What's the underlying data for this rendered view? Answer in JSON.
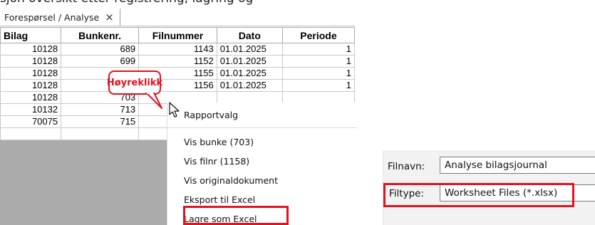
{
  "partial_heading": "sjon oversikt etter registrering, lagring og",
  "tab": {
    "label": "Forespørsel / Analyse",
    "close": "×"
  },
  "table": {
    "headers": [
      "Bilag",
      "Bunkenr.",
      "Filnummer",
      "Dato",
      "Periode"
    ],
    "rows": [
      [
        "10128",
        "689",
        "1143",
        "01.01.2025",
        "1"
      ],
      [
        "10128",
        "699",
        "1152",
        "01.01.2025",
        "1"
      ],
      [
        "10128",
        "",
        "1155",
        "01.01.2025",
        "1"
      ],
      [
        "10128",
        "",
        "1156",
        "01.01.2025",
        "1"
      ],
      [
        "10128",
        "703",
        "",
        "",
        ""
      ],
      [
        "10132",
        "713",
        "",
        "",
        ""
      ],
      [
        "70075",
        "715",
        "",
        "",
        ""
      ],
      [
        "",
        "",
        "",
        "",
        ""
      ]
    ]
  },
  "callout": {
    "label": "Høyreklikk",
    "color": "#e2121f"
  },
  "context_menu": {
    "items": [
      "Rapportvalg",
      "Vis bunke (703)",
      "Vis filnr (1158)",
      "Vis originaldokument",
      "Eksport til Excel",
      "Lagre som Excel"
    ]
  },
  "save_dialog": {
    "filename_label": "Filnavn:",
    "filename_value": "Analyse bilagsjournal",
    "filetype_label": "Filtype:",
    "filetype_value": "Worksheet Files (*.xlsx)"
  },
  "colors": {
    "highlight": "#e2121f",
    "grid_background": "#ababab"
  }
}
